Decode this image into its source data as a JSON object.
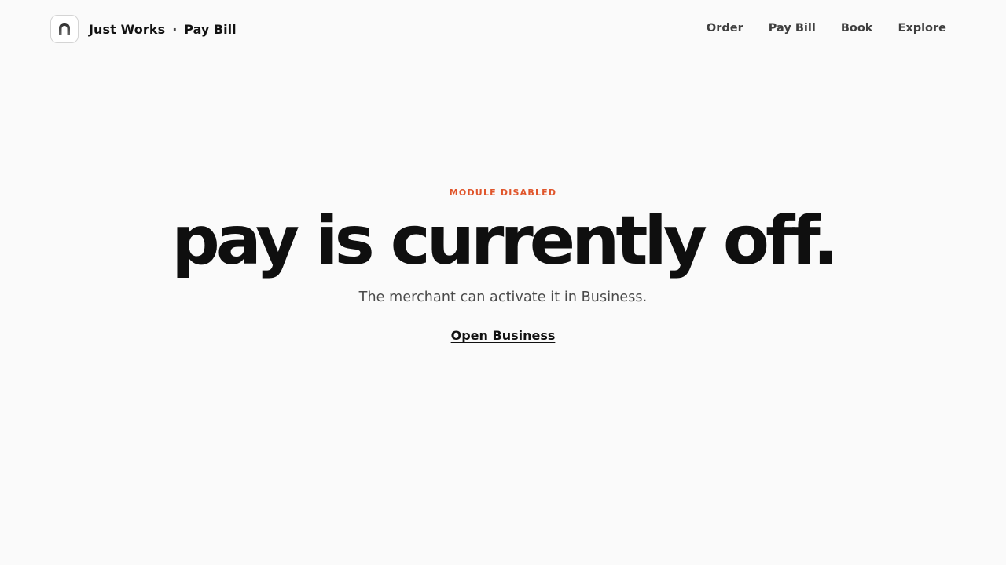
{
  "header": {
    "brand_name": "Just Works",
    "separator": "·",
    "page_name": "Pay Bill",
    "logo_icon": "arch-icon",
    "nav": [
      {
        "label": "Order"
      },
      {
        "label": "Pay Bill"
      },
      {
        "label": "Book"
      },
      {
        "label": "Explore"
      }
    ]
  },
  "main": {
    "eyebrow": "MODULE DISABLED",
    "headline": "pay is currently off.",
    "subtext": "The merchant can activate it in Business.",
    "cta_label": "Open Business"
  },
  "colors": {
    "background": "#fafafa",
    "accent": "#e0552b",
    "text": "#111111"
  }
}
